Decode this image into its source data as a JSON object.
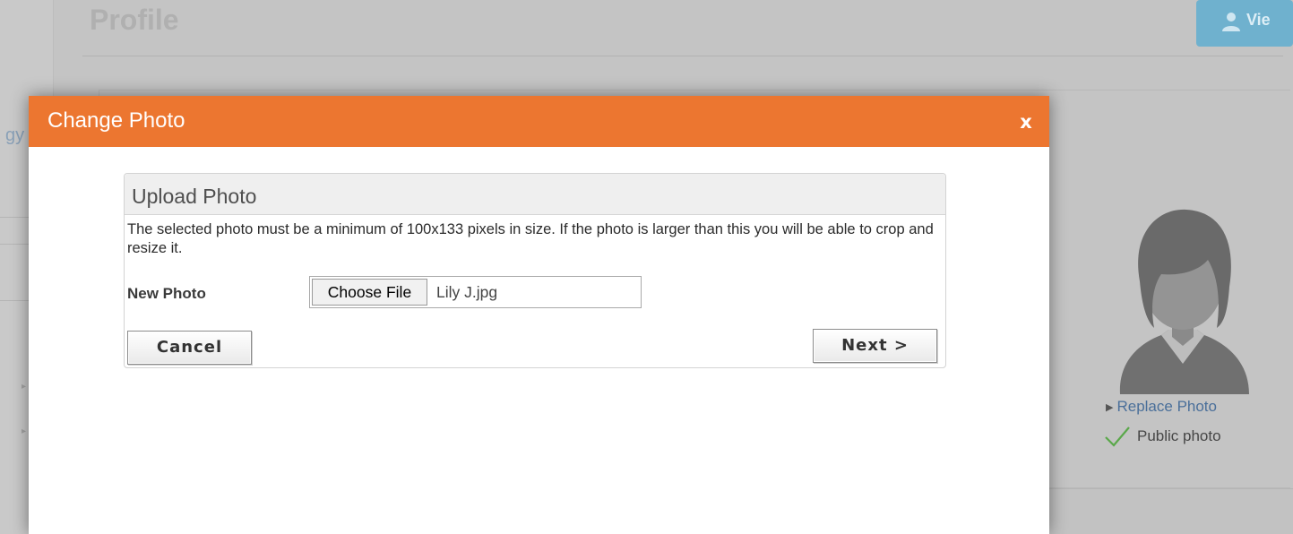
{
  "background": {
    "page_title": "Profile",
    "sidebar_fragment": "gy",
    "view_button_label": "Vie",
    "replace_photo_link": "Replace Photo",
    "public_photo_label": "Public photo"
  },
  "modal": {
    "title": "Change Photo",
    "close_label": "x",
    "accent_color": "#ec7630",
    "upload": {
      "heading": "Upload Photo",
      "description": "The selected photo must be a minimum of 100x133 pixels in size. If the photo is larger than this you will be able to crop and resize it.",
      "new_photo_label": "New Photo",
      "choose_file_label": "Choose File",
      "file_name": "Lily J.jpg",
      "cancel_label": "Cancel",
      "next_label": "Next >"
    }
  },
  "icons": {
    "close": "close-icon",
    "avatar": "avatar-silhouette-icon",
    "replace_arrow": "triangle-right-icon",
    "public_check": "checkmark-icon",
    "view_user": "user-icon"
  }
}
